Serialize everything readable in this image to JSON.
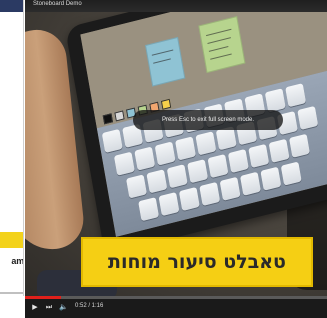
{
  "left_panel": {
    "caption": "am"
  },
  "video": {
    "window_title": "Stoneboard Demo",
    "tooltip": "Press Esc to exit full screen mode.",
    "banner_text": "טאבלט סיעור מוחות",
    "palette_colors": [
      "#111111",
      "#d9d9d9",
      "#8fc3d4",
      "#b7d48e",
      "#f2a66f",
      "#f7d04a"
    ],
    "keyboard_rows": [
      10,
      10,
      9,
      8
    ]
  },
  "player": {
    "time": "0:52 / 1:16",
    "progress": 0.12,
    "play_icon": "play-icon",
    "next_icon": "skip-next-icon",
    "volume_icon": "volume-icon",
    "accent": "#e0201b"
  }
}
